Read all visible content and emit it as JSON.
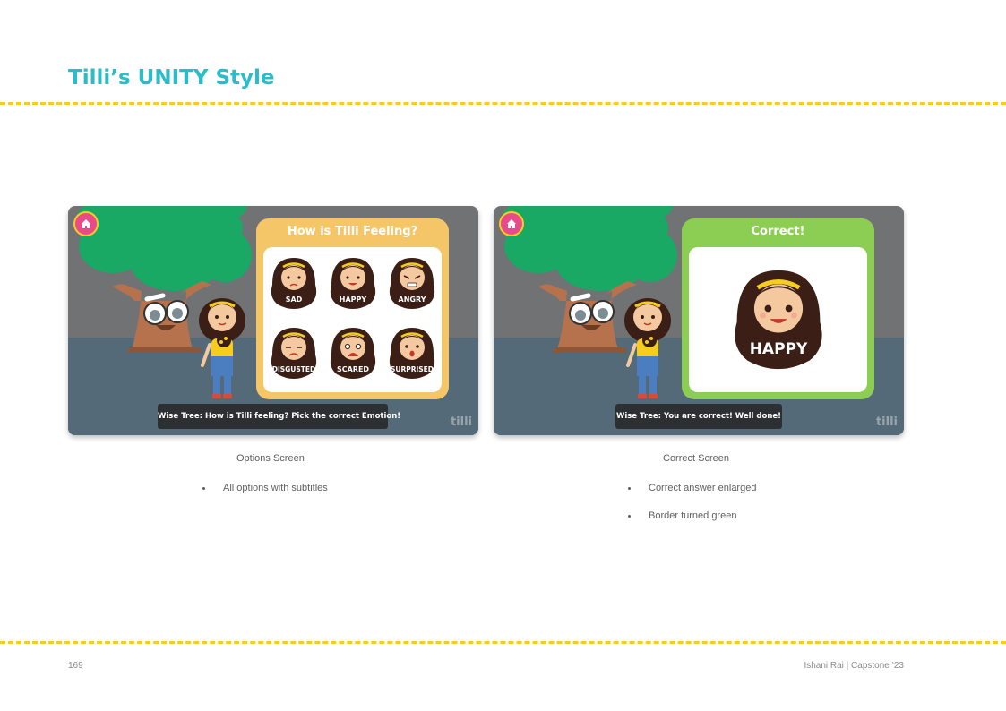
{
  "page": {
    "title": "Tilli’s UNITY Style",
    "page_number": "169",
    "footer_credit": "Ishani Rai | Capstone ’23",
    "colors": {
      "title": "#2bbcc8",
      "dash": "#f6cd1d"
    }
  },
  "options_screen": {
    "panel_title": "How is Tilli Feeling?",
    "faces": [
      "SAD",
      "HAPPY",
      "ANGRY",
      "DISGUSTED",
      "SCARED",
      "SURPRISED"
    ],
    "subtitle": "Wise Tree: How is Tilli feeling? Pick the correct Emotion!",
    "watermark": "tilli",
    "panel_color": "#f4c668"
  },
  "correct_screen": {
    "panel_title": "Correct!",
    "face_label": "HAPPY",
    "subtitle": "Wise Tree: You are correct! Well done!",
    "watermark": "tilli",
    "panel_color": "#8ccd54"
  },
  "captions": {
    "left": {
      "title": "Options Screen",
      "bullets": [
        "All options with subtitles"
      ]
    },
    "right": {
      "title": "Correct Screen",
      "bullets": [
        "Correct answer enlarged",
        "Border turned green"
      ]
    }
  }
}
